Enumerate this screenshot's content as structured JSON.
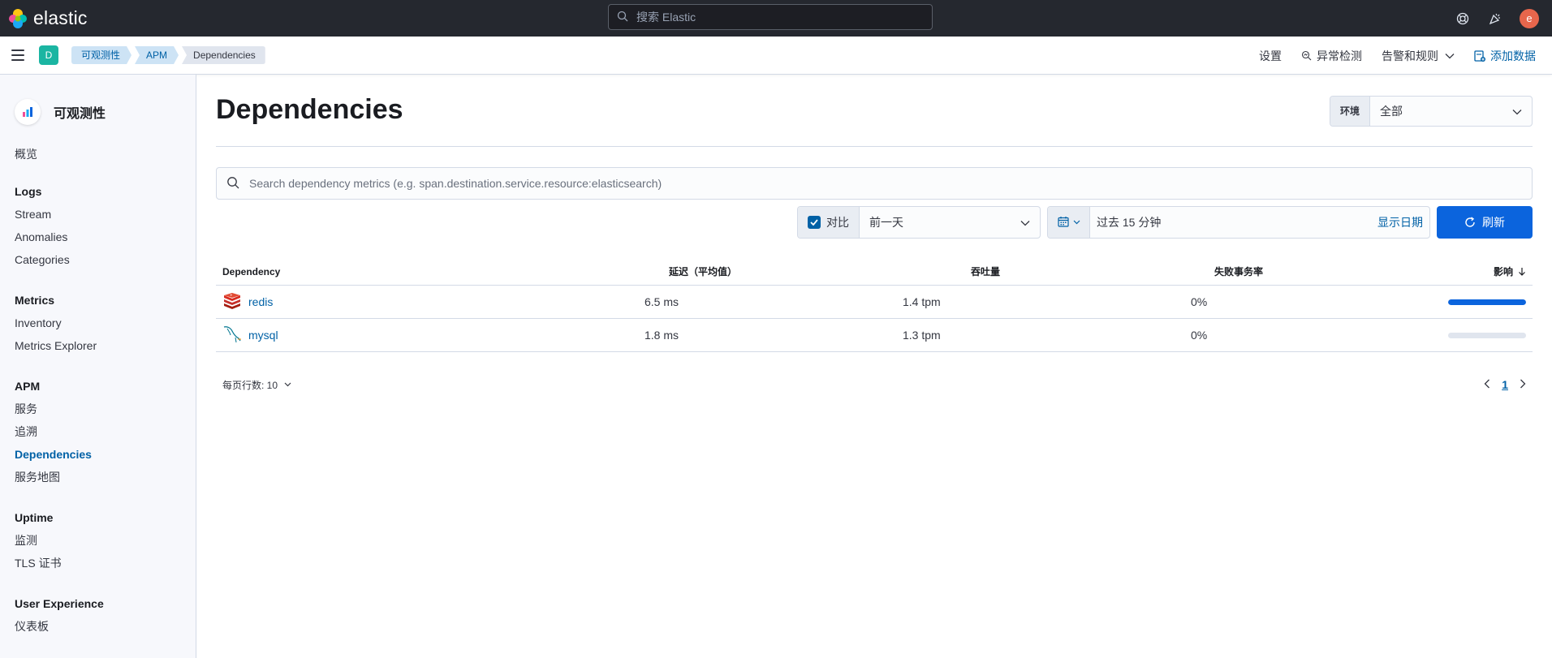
{
  "header": {
    "brand": "elastic",
    "search_placeholder": "搜索 Elastic",
    "avatar_letter": "e"
  },
  "subbar": {
    "space_letter": "D",
    "breadcrumbs": [
      "可观测性",
      "APM",
      "Dependencies"
    ],
    "links": {
      "settings": "设置",
      "anomaly": "异常检测",
      "alerts": "告警和规则",
      "add_data": "添加数据"
    }
  },
  "sidebar": {
    "title": "可观测性",
    "overview": "概览",
    "sections": [
      {
        "title": "Logs",
        "items": [
          "Stream",
          "Anomalies",
          "Categories"
        ]
      },
      {
        "title": "Metrics",
        "items": [
          "Inventory",
          "Metrics Explorer"
        ]
      },
      {
        "title": "APM",
        "items": [
          "服务",
          "追溯",
          "Dependencies",
          "服务地图"
        ]
      },
      {
        "title": "Uptime",
        "items": [
          "监测",
          "TLS 证书"
        ]
      },
      {
        "title": "User Experience",
        "items": [
          "仪表板"
        ]
      }
    ]
  },
  "main": {
    "title": "Dependencies",
    "environment": {
      "label": "环境",
      "value": "全部"
    },
    "search_placeholder": "Search dependency metrics (e.g. span.destination.service.resource:elasticsearch)",
    "compare": {
      "label": "对比",
      "value": "前一天"
    },
    "date": {
      "value": "过去 15 分钟",
      "show": "显示日期"
    },
    "refresh": "刷新",
    "table": {
      "headers": [
        "Dependency",
        "延迟（平均值）",
        "吞吐量",
        "失败事务率",
        "影响"
      ],
      "rows": [
        {
          "name": "redis",
          "latency": "6.5 ms",
          "throughput": "1.4 tpm",
          "failure": "0%",
          "impact": 1.0
        },
        {
          "name": "mysql",
          "latency": "1.8 ms",
          "throughput": "1.3 tpm",
          "failure": "0%",
          "impact": 0.0
        }
      ]
    },
    "pagination": {
      "rows_per_page": "每页行数: 10",
      "current_page": "1"
    }
  },
  "colors": {
    "header_bg": "#25282f",
    "accent": "#0b64dd",
    "link": "#0061a6",
    "space_badge": "#1bb5a2",
    "avatar": "#e7664c",
    "redis_red": "#d82c20"
  }
}
